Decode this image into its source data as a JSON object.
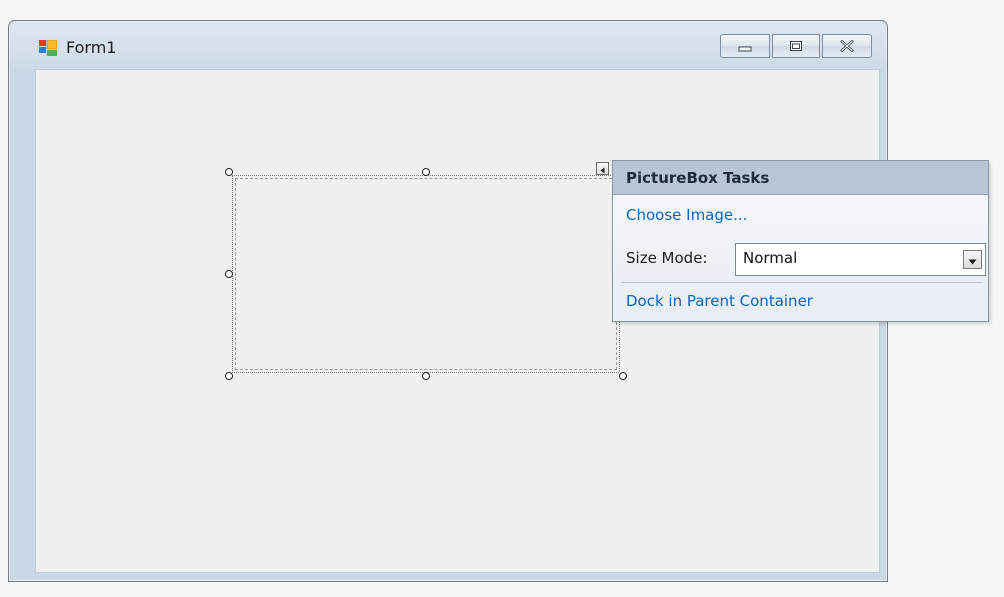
{
  "form": {
    "title": "Form1",
    "icon": "form-icon"
  },
  "caption_buttons": {
    "minimize_icon": "minimize-icon",
    "maximize_icon": "maximize-icon",
    "close_icon": "close-icon"
  },
  "picturebox": {
    "smart_tag_icon": "smart-tag-arrow-icon"
  },
  "tasks_panel": {
    "title": "PictureBox Tasks",
    "choose_image_link": "Choose Image...",
    "size_mode_label": "Size Mode:",
    "size_mode_value": "Normal",
    "dock_link": "Dock in Parent Container",
    "dropdown_icon": "chevron-down-icon"
  },
  "colors": {
    "link": "#0c63c7",
    "panel_header": "#b8c5d6",
    "client_area": "#f0f0f0",
    "window_frame": "#c9d7e7"
  }
}
